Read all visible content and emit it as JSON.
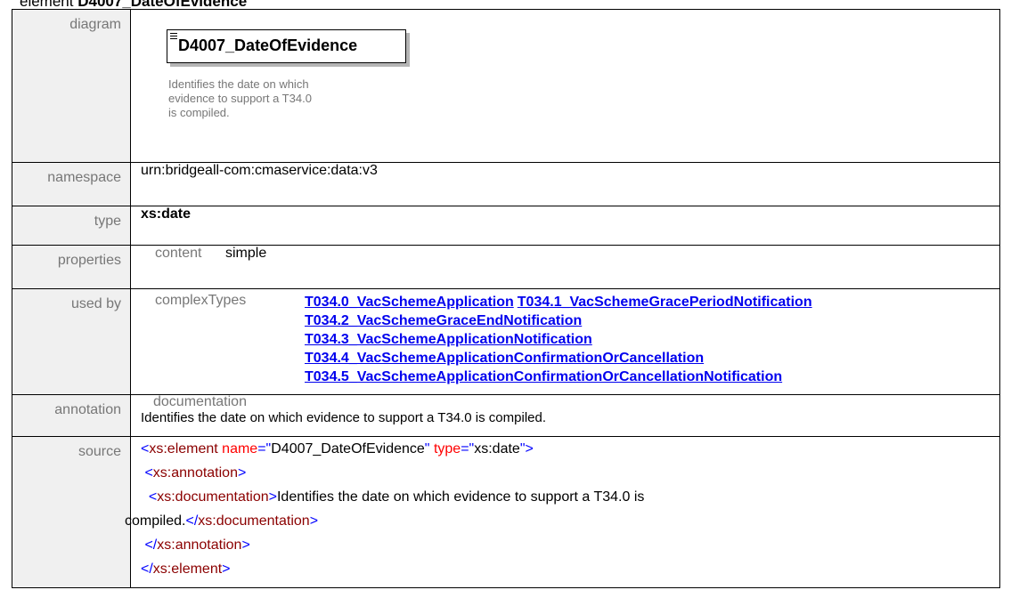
{
  "page_title": {
    "prefix": "element",
    "name": "D4007_DateOfEvidence"
  },
  "rows": {
    "diagram": {
      "label": "diagram",
      "element_name": "D4007_DateOfEvidence",
      "doc_text": "Identifies the date on which evidence to support a T34.0 is compiled."
    },
    "namespace": {
      "label": "namespace",
      "value": "urn:bridgeall-com:cmaservice:data:v3"
    },
    "type": {
      "label": "type",
      "value": "xs:date"
    },
    "properties": {
      "label": "properties",
      "key": "content",
      "value": "simple"
    },
    "used_by": {
      "label": "used by",
      "key": "complexTypes",
      "links": [
        "T034.0_VacSchemeApplication",
        "T034.1_VacSchemeGracePeriodNotification",
        "T034.2_VacSchemeGraceEndNotification",
        "T034.3_VacSchemeApplicationNotification",
        "T034.4_VacSchemeApplicationConfirmationOrCancellation",
        "T034.5_VacSchemeApplicationConfirmationOrCancellationNotification"
      ]
    },
    "annotation": {
      "label": "annotation",
      "key": "documentation",
      "value": "Identifies the date on which evidence to support a T34.0 is compiled."
    },
    "source": {
      "label": "source",
      "el_open": "xs:element",
      "attr_name": "name",
      "attr_name_val": "D4007_DateOfEvidence",
      "attr_type": "type",
      "attr_type_val": "xs:date",
      "annotation_tag": "xs:annotation",
      "documentation_tag": "xs:documentation",
      "doc_line1": "Identifies the date on which evidence to support a T34.0 is",
      "doc_line2": "compiled."
    }
  }
}
